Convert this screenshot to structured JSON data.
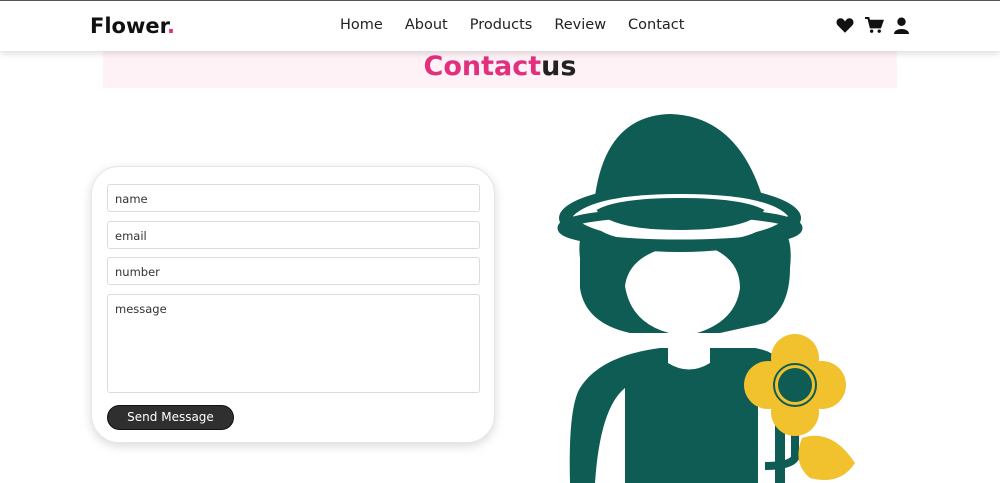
{
  "header": {
    "logo_text": "Flower",
    "logo_dot": ".",
    "nav": [
      "Home",
      "About",
      "Products",
      "Review",
      "Contact"
    ],
    "icons": [
      "heart-icon",
      "cart-icon",
      "user-icon"
    ]
  },
  "title": {
    "highlight": "Contact",
    "rest": "us"
  },
  "form": {
    "name_placeholder": "name",
    "email_placeholder": "email",
    "number_placeholder": "number",
    "message_placeholder": "message",
    "submit_label": "Send Message"
  },
  "colors": {
    "accent": "#e0307e",
    "title_band": "#fff2f7",
    "figure_green": "#0e5c53",
    "flower_yellow": "#f2c12e",
    "button": "#2f2f2f"
  }
}
